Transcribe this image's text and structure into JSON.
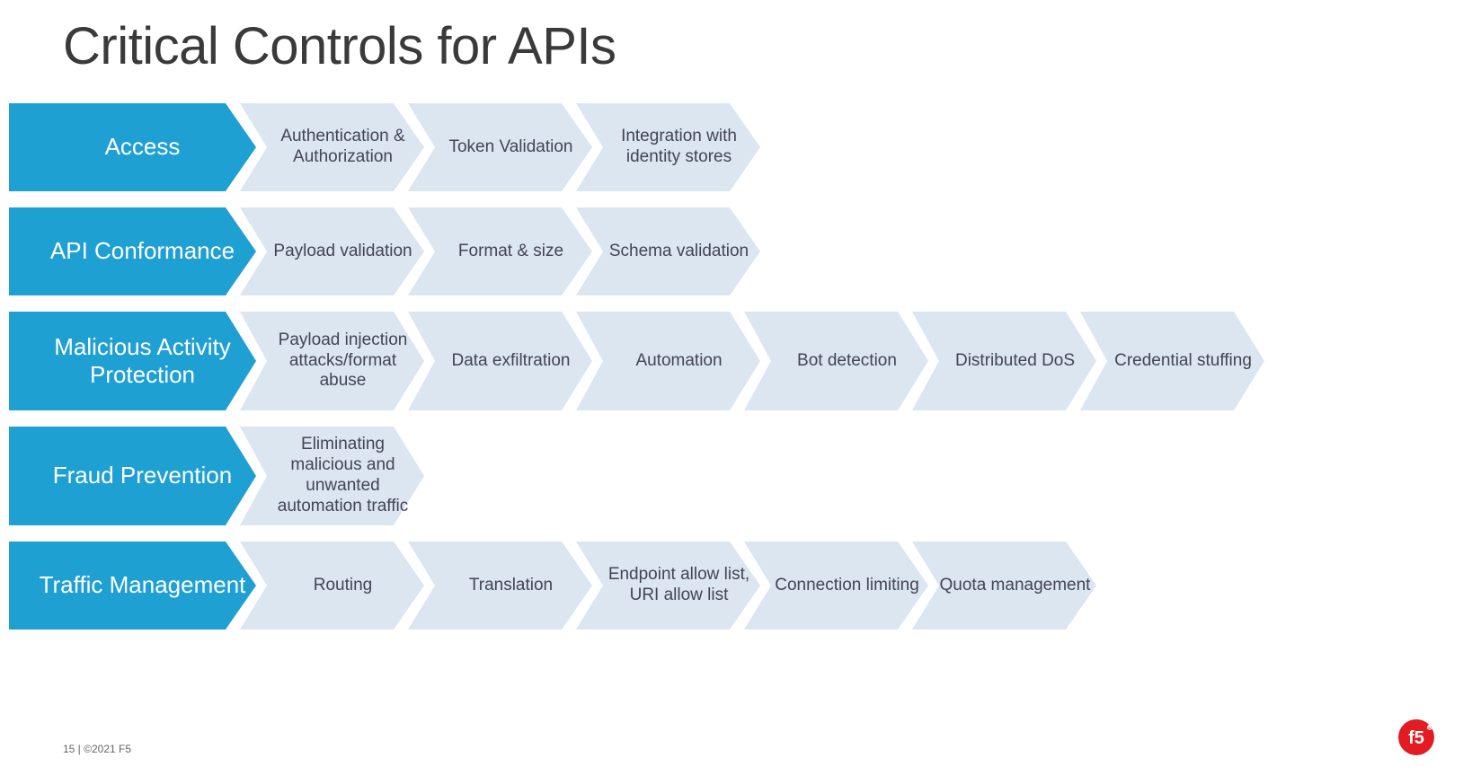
{
  "title": "Critical Controls for APIs",
  "footer": "15 | ©2021 F5",
  "colors": {
    "category_fill": "#1ea0d3",
    "item_fill": "#dbe6f0",
    "logo_fill": "#e31b23"
  },
  "rows": [
    {
      "category": "Access",
      "items": [
        "Authentication & Authorization",
        "Token Validation",
        "Integration with identity stores"
      ]
    },
    {
      "category": "API Conformance",
      "items": [
        "Payload validation",
        "Format & size",
        "Schema validation"
      ]
    },
    {
      "category": "Malicious Activity Protection",
      "items": [
        "Payload injection attacks/format abuse",
        "Data exfiltration",
        "Automation",
        "Bot detection",
        "Distributed DoS",
        "Credential stuffing"
      ],
      "tall": true
    },
    {
      "category": "Fraud Prevention",
      "items": [
        "Eliminating malicious and unwanted automation traffic"
      ],
      "tall": true
    },
    {
      "category": "Traffic Management",
      "items": [
        "Routing",
        "Translation",
        "Endpoint allow list, URI allow list",
        "Connection limiting",
        "Quota management"
      ]
    }
  ]
}
